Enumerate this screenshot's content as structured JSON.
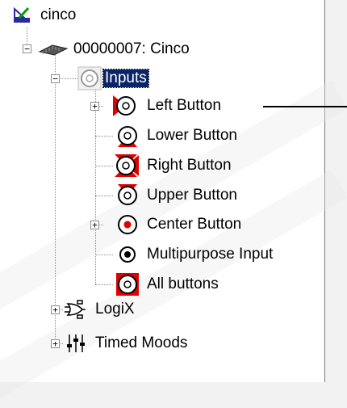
{
  "tree": {
    "root": {
      "label": "cinco"
    },
    "device": {
      "label": "00000007: Cinco"
    },
    "inputs": {
      "label": "Inputs"
    },
    "items": [
      {
        "label": "Left Button"
      },
      {
        "label": "Lower Button"
      },
      {
        "label": "Right Button"
      },
      {
        "label": "Upper Button"
      },
      {
        "label": "Center Button"
      },
      {
        "label": "Multipurpose Input"
      },
      {
        "label": "All buttons"
      }
    ],
    "logix": {
      "label": "LogiX"
    },
    "timed": {
      "label": "Timed Moods"
    }
  },
  "colors": {
    "highlight": "#e00000",
    "selection": "#0a246a"
  }
}
